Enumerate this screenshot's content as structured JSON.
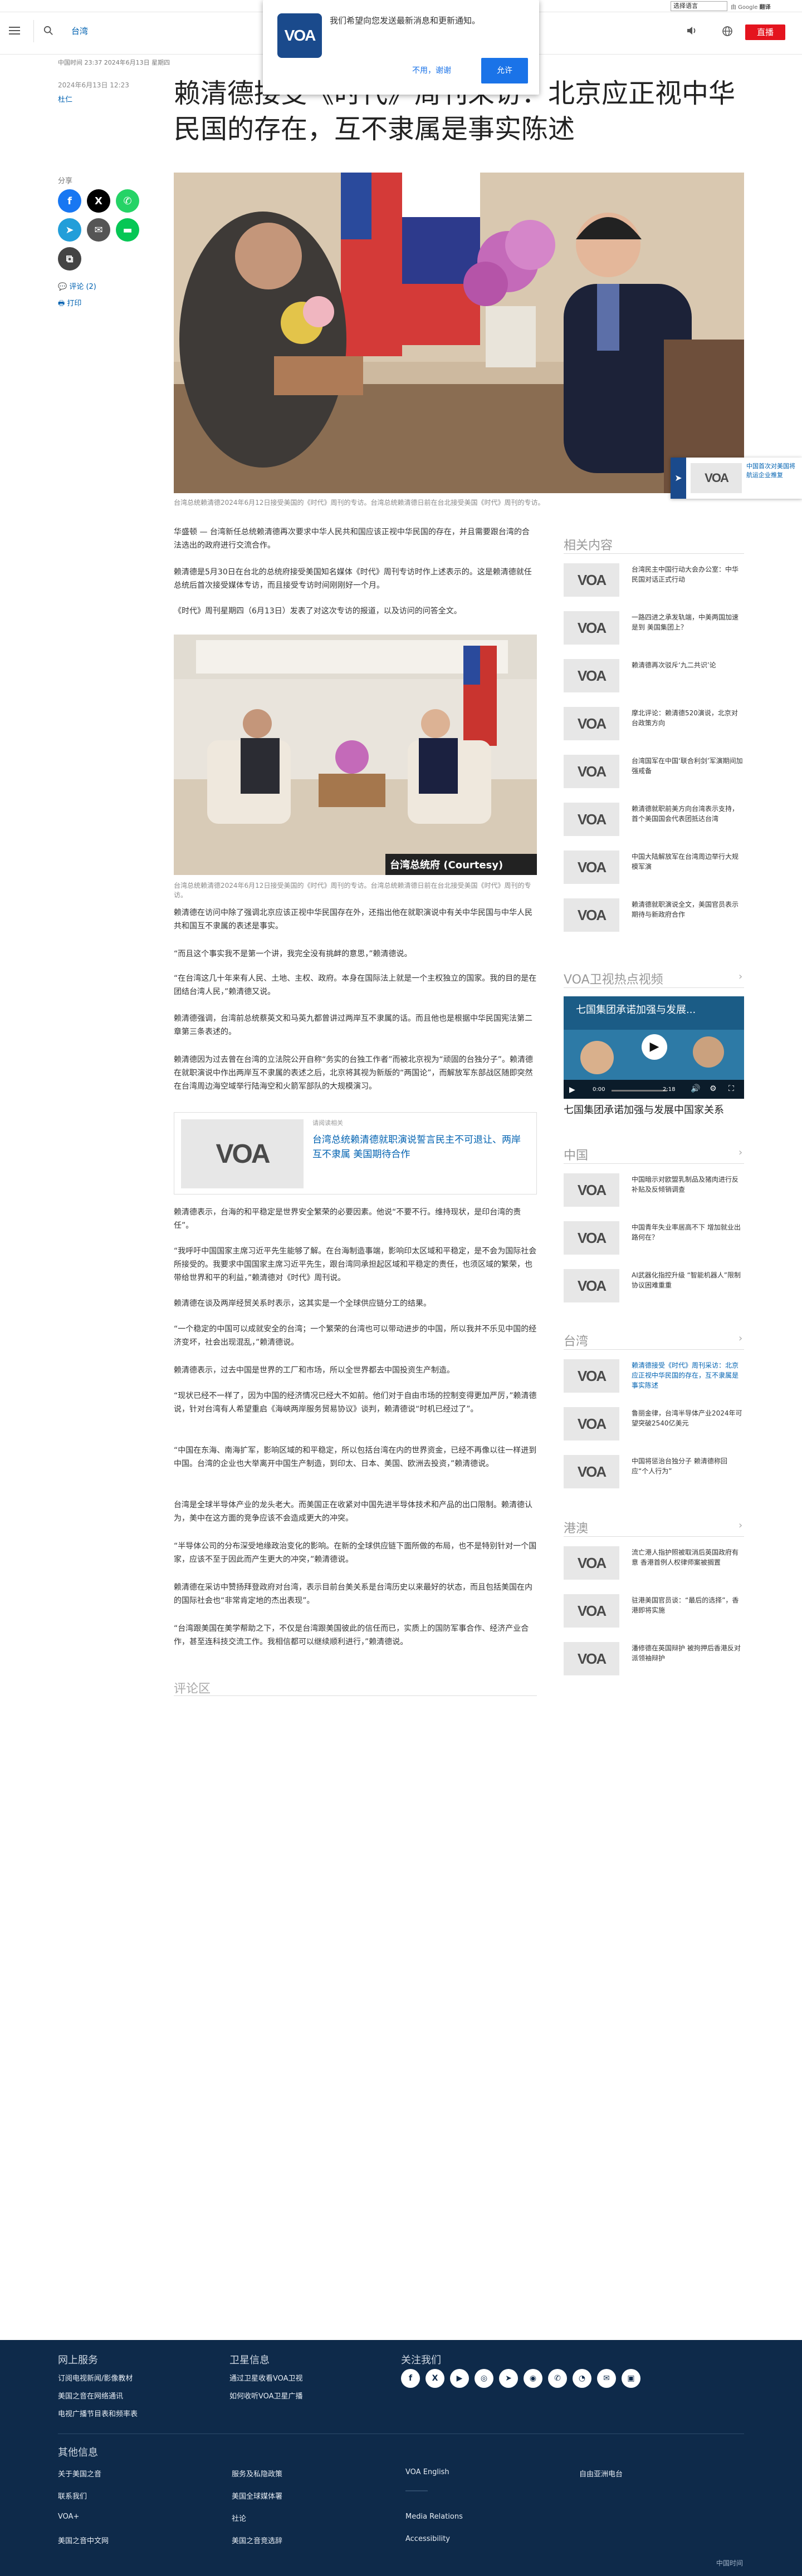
{
  "utility": {
    "language_select": "选择语言",
    "translate_by": "由 Google",
    "translate_word": "翻译"
  },
  "header": {
    "section": "台湾",
    "live": "直播"
  },
  "notification": {
    "message": "我们希望向您发送最新消息和更新通知。",
    "decline": "不用，谢谢",
    "accept": "允许",
    "logo": "VOA"
  },
  "article": {
    "meta_time": "中国时间 23:37 2024年6月13日 星期四",
    "date": "2024年6月13日 12:23",
    "author": "杜仁",
    "headline": "赖清德接受《时代》周刊采访：北京应正视中华民国的存在，互不隶属是事实陈述",
    "share_label": "分享",
    "comments_link": "评论 (2)",
    "print_link": "打印",
    "hero_caption": "台湾总统赖清德2024年6月12日接受美国的《时代》周刊的专访。台湾总统赖清德日前在台北接受美国《时代》周刊的专访。",
    "img2_caption": "台湾总统赖清德2024年6月12日接受美国的《时代》周刊的专访。台湾总统赖清德日前在台北接受美国《时代》周刊的专访。",
    "img2_credit": "台湾总统府 (Courtesy)",
    "paragraphs_a": [
      "华盛顿 — 台湾新任总统赖清德再次要求中华人民共和国应该正视中华民国的存在，并且需要跟台湾的合法选出的政府进行交流合作。",
      "赖清德是5月30日在台北的总统府接受美国知名媒体《时代》周刊专访时作上述表示的。这是赖清德就任总统后首次接受媒体专访，而且接受专访时间刚刚好一个月。",
      "《时代》周刊星期四（6月13日）发表了对这次专访的报道，以及访问的问答全文。"
    ],
    "paragraphs_b": [
      "赖清德在访问中除了强调北京应该正视中华民国存在外，还指出他在就职演说中有关中华民国与中华人民共和国互不隶属的表述是事实。",
      "“而且这个事实我不是第一个讲，我完全没有挑衅的意思，”赖清德说。",
      "“在台湾这几十年来有人民、土地、主权、政府。本身在国际法上就是一个主权独立的国家。我的目的是在团结台湾人民，”赖清德又说。",
      "赖清德强调，台湾前总统蔡英文和马英九都曾讲过两岸互不隶属的话。而且他也是根据中华民国宪法第二章第三条表述的。",
      "赖清德因为过去曾在台湾的立法院公开自称“务实的台独工作者”而被北京视为“顽固的台独分子”。赖清德在就职演说中作出两岸互不隶属的表述之后，北京将其视为新版的“两国论”，而解放军东部战区随即突然在台湾周边海空域举行陆海空和火箭军部队的大规模演习。"
    ],
    "related_label": "请阅读相关",
    "related_title": "台湾总统赖清德就职演说誓言民主不可退让、两岸互不隶属 美国期待合作",
    "paragraphs_c": [
      "赖清德表示，台海的和平稳定是世界安全繁荣的必要因素。他说“不要不行。维持现状，是印台湾的责任”。",
      "“我呼吁中国国家主席习近平先生能够了解。在台海制造事端，影响印太区域和平稳定，是不会为国际社会所接受的。我要求中国国家主席习近平先生，跟台湾同承担起区域和平稳定的责任，也须区域的繁荣，也带给世界和平的利益，”赖清德对《时代》周刊说。",
      "赖清德在谈及两岸经贸关系时表示，这其实是一个全球供应链分工的结果。",
      "“一个稳定的中国可以成就安全的台湾；一个繁荣的台湾也可以带动进步的中国，所以我并不乐见中国的经济变坏，社会出现混乱，”赖清德说。",
      "赖清德表示，过去中国是世界的工厂和市场，所以全世界都去中国投资生产制造。",
      "“现状已经不一样了，因为中国的经济情况已经大不如前。他们对于自由市场的控制变得更加严厉，”赖清德说，针对台湾有人希望重启《海峡两岸服务贸易协议》谈判，赖清德说“时机已经过了”。",
      "“中国在东海、南海扩军，影响区域的和平稳定，所以包括台湾在内的世界资金，已经不再像以往一样进到中国。台湾的企业也大举离开中国生产制造，到印太、日本、美国、欧洲去投资，”赖清德说。",
      "台湾是全球半导体产业的龙头老大。而美国正在收紧对中国先进半导体技术和产品的出口限制。赖清德认为，美中在这方面的竞争应该不会造成更大的冲突。",
      "“半导体公司的分布深受地缘政治变化的影响。在新的全球供应链下面所做的布局，也不是特别针对一个国家，应该不至于因此而产生更大的冲突，”赖清德说。",
      "赖清德在采访中赞扬拜登政府对台湾，表示目前台美关系是台湾历史以来最好的状态，而且包括美国在内的国际社会也“非常肯定地的杰出表现”。",
      "“台湾跟美国在美学帮助之下，不仅是台湾跟美国彼此的信任而已，实质上的国防军事合作、经济产业合作，甚至连科技交流工作。我相信都可以继续顺利进行，”赖清德说。"
    ],
    "comments_title": "评论区"
  },
  "float_card": {
    "text": "中国首次对美国将航运企业推复"
  },
  "rail": {
    "related_title": "相关内容",
    "related": [
      "台湾民主中国行动大会办公室：中华民国对话正式行动",
      "一路四进之承发轨端，中美两国加速是到 美国集团上？",
      "赖清德再次驳斥‘九二共识’论",
      "摩北评论：赖清德520演说，北京对台政策方向",
      "台湾国军在中国‘联合利剑’军演期间加强戒备",
      "赖清德就职前美方向台湾表示支持，首个美国国会代表团抵达台湾",
      "中国大陆解放军在台湾周边举行大规模军演",
      "赖清德就职演说全文，美国官员表示期待与新政府合作"
    ],
    "video_title": "VOA卫视热点视频",
    "video_overlay": "七国集团承诺加强与发展...",
    "video_time_a": "0:00",
    "video_time_b": "2:18",
    "video_caption": "七国集团承诺加强与发展中国家关系",
    "china_title": "中国",
    "china": [
      "中国暗示对欧盟乳制品及猪肉进行反补贴及反倾销调查",
      "中国青年失业率居高不下 增加就业出路何在？",
      "AI武器化指控升级 “智能机器人”限制协议困难重重"
    ],
    "taiwan_title": "台湾",
    "taiwan": [
      "赖清德接受《时代》周刊采访：北京应正视中华民国的存在，互不隶属是事实陈述",
      "鲁丽金律，台湾半导体产业2024年可望突破2540亿美元",
      "中国将惩治台独分子 赖清德称回应“个人行为”"
    ],
    "hk_title": "港澳",
    "hk": [
      "流亡港人指护照被取消后英国政府有意 香港首例人权律师案被搁置",
      "驻港美国官员谈：“最后的选择”，香港即将实施",
      "潘修德在英国辩护 被拘押后香港反对派领袖辩护"
    ]
  },
  "footer": {
    "col1_title": "网上服务",
    "col1": [
      "订阅电视新闻/影像教材",
      "美国之音在网络通讯",
      "电视广播节目表和频率表"
    ],
    "col2_title": "卫星信息",
    "col2": [
      "通过卫星收看VOA卫视",
      "如何收听VOA卫星广播"
    ],
    "col3_title": "关注我们",
    "other_title": "其他信息",
    "other": [
      [
        "关于美国之音",
        "美国之音中文网"
      ],
      [
        "联系我们",
        "VOA+"
      ],
      [
        "美国之音简史",
        "服务及私隐政策"
      ],
      [
        "美国全球媒体署",
        "社论"
      ],
      [
        "美国之音竞选辞",
        "VOA English"
      ],
      [
        "Media Relations",
        "Accessibility"
      ],
      [
        "自由亚洲电台"
      ]
    ],
    "brand": "中国时间",
    "social_icons": [
      "facebook-icon",
      "x-icon",
      "youtube-icon",
      "instagram-icon",
      "telegram-icon",
      "podcast-icon",
      "whatsapp-icon",
      "rss-icon",
      "email-icon",
      "app-icon"
    ]
  },
  "colors": {
    "accent": "#0162b1",
    "live": "#e4141e",
    "footer_bg": "#0e2a4a",
    "facebook": "#1877f2",
    "x": "#000000",
    "whatsapp": "#25d366",
    "telegram": "#229ed9",
    "line": "#06c755",
    "email": "#555555",
    "copy": "#444444"
  }
}
